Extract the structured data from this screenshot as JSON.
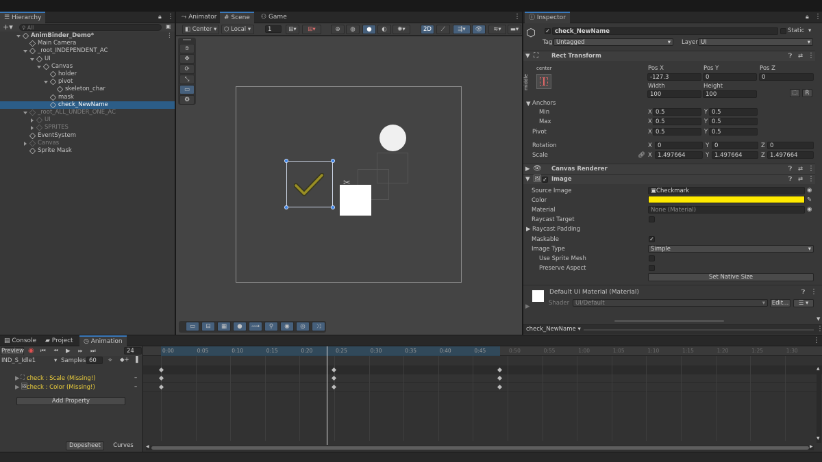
{
  "hierarchy": {
    "tab": "Hierarchy",
    "search_placeholder": "All",
    "items": [
      {
        "label": "AnimBinder_Demo*",
        "depth": 0,
        "state": "root"
      },
      {
        "label": "Main Camera",
        "depth": 1,
        "state": "leaf"
      },
      {
        "label": "_root_INDEPENDENT_AC",
        "depth": 1,
        "state": "open"
      },
      {
        "label": "UI",
        "depth": 2,
        "state": "open"
      },
      {
        "label": "Canvas",
        "depth": 3,
        "state": "open"
      },
      {
        "label": "holder",
        "depth": 4,
        "state": "leaf"
      },
      {
        "label": "pivot",
        "depth": 4,
        "state": "open"
      },
      {
        "label": "skeleton_char",
        "depth": 5,
        "state": "leaf"
      },
      {
        "label": "mask",
        "depth": 4,
        "state": "leaf"
      },
      {
        "label": "check_NewName",
        "depth": 4,
        "state": "leaf",
        "selected": true
      },
      {
        "label": "_root_ALL_UNDER_ONE_AC",
        "depth": 1,
        "state": "open",
        "disabled": true
      },
      {
        "label": "UI",
        "depth": 2,
        "state": "closed",
        "disabled": true
      },
      {
        "label": "SPRITES",
        "depth": 2,
        "state": "closed",
        "disabled": true
      },
      {
        "label": "EventSystem",
        "depth": 1,
        "state": "leaf"
      },
      {
        "label": "Canvas",
        "depth": 1,
        "state": "closed",
        "disabled": true
      },
      {
        "label": "Sprite Mask",
        "depth": 1,
        "state": "leaf"
      }
    ]
  },
  "scene": {
    "tabs": [
      "Animator",
      "Scene",
      "Game"
    ],
    "active_tab": "Scene",
    "toolbar": {
      "pivot": "Center",
      "space": "Local",
      "grid_snap": "1",
      "mode_2d": "2D"
    }
  },
  "inspector": {
    "tab": "Inspector",
    "object_name": "check_NewName",
    "static_label": "Static",
    "tag_label": "Tag",
    "tag_value": "Untagged",
    "layer_label": "Layer",
    "layer_value": "UI",
    "rect_transform": {
      "title": "Rect Transform",
      "anchor_h": "center",
      "anchor_v": "middle",
      "pos_x_label": "Pos X",
      "pos_y_label": "Pos Y",
      "pos_z_label": "Pos Z",
      "pos_x": "-127.3",
      "pos_y": "0",
      "pos_z": "0",
      "width_label": "Width",
      "height_label": "Height",
      "width": "100",
      "height": "100",
      "r_button": "R",
      "anchors_label": "Anchors",
      "min_label": "Min",
      "max_label": "Max",
      "min_x": "0.5",
      "min_y": "0.5",
      "max_x": "0.5",
      "max_y": "0.5",
      "pivot_label": "Pivot",
      "pivot_x": "0.5",
      "pivot_y": "0.5",
      "rotation_label": "Rotation",
      "rot_x": "0",
      "rot_y": "0",
      "rot_z": "0",
      "scale_label": "Scale",
      "scale_x": "1.497664",
      "scale_y": "1.497664",
      "scale_z": "1.497664",
      "axis_x": "X",
      "axis_y": "Y",
      "axis_z": "Z"
    },
    "canvas_renderer": {
      "title": "Canvas Renderer"
    },
    "image": {
      "title": "Image",
      "source_image_label": "Source Image",
      "source_image": "Checkmark",
      "color_label": "Color",
      "color_value": "#ffea00",
      "material_label": "Material",
      "material": "None (Material)",
      "raycast_target_label": "Raycast Target",
      "raycast_padding_label": "Raycast Padding",
      "maskable_label": "Maskable",
      "image_type_label": "Image Type",
      "image_type": "Simple",
      "use_sprite_mesh_label": "Use Sprite Mesh",
      "preserve_aspect_label": "Preserve Aspect",
      "set_native_size": "Set Native Size"
    },
    "material_section": {
      "title": "Default UI Material (Material)",
      "shader_label": "Shader",
      "shader": "UI/Default",
      "edit_button": "Edit..."
    },
    "footer": "check_NewName"
  },
  "bottom": {
    "tabs": [
      "Console",
      "Project",
      "Animation"
    ],
    "active_tab": "Animation",
    "preview": "Preview",
    "frame": "24",
    "clip": "IND_S_Idle1",
    "samples_label": "Samples",
    "samples": "60",
    "properties": [
      "check : Scale (Missing!)",
      "check : Color (Missing!)"
    ],
    "add_property": "Add Property",
    "dopesheet": "Dopesheet",
    "curves": "Curves",
    "timeline_ticks": [
      "0:00",
      "0:05",
      "0:10",
      "0:15",
      "0:20",
      "0:25",
      "0:30",
      "0:35",
      "0:40",
      "0:45",
      "0:50",
      "0:55",
      "1:00",
      "1:05",
      "1:10",
      "1:15",
      "1:20",
      "1:25",
      "1:30"
    ]
  },
  "colors": {
    "selection": "#2c5d87",
    "accent": "#3a79bb",
    "missing_text": "#f0d23c",
    "image_color": "#ffea00"
  }
}
